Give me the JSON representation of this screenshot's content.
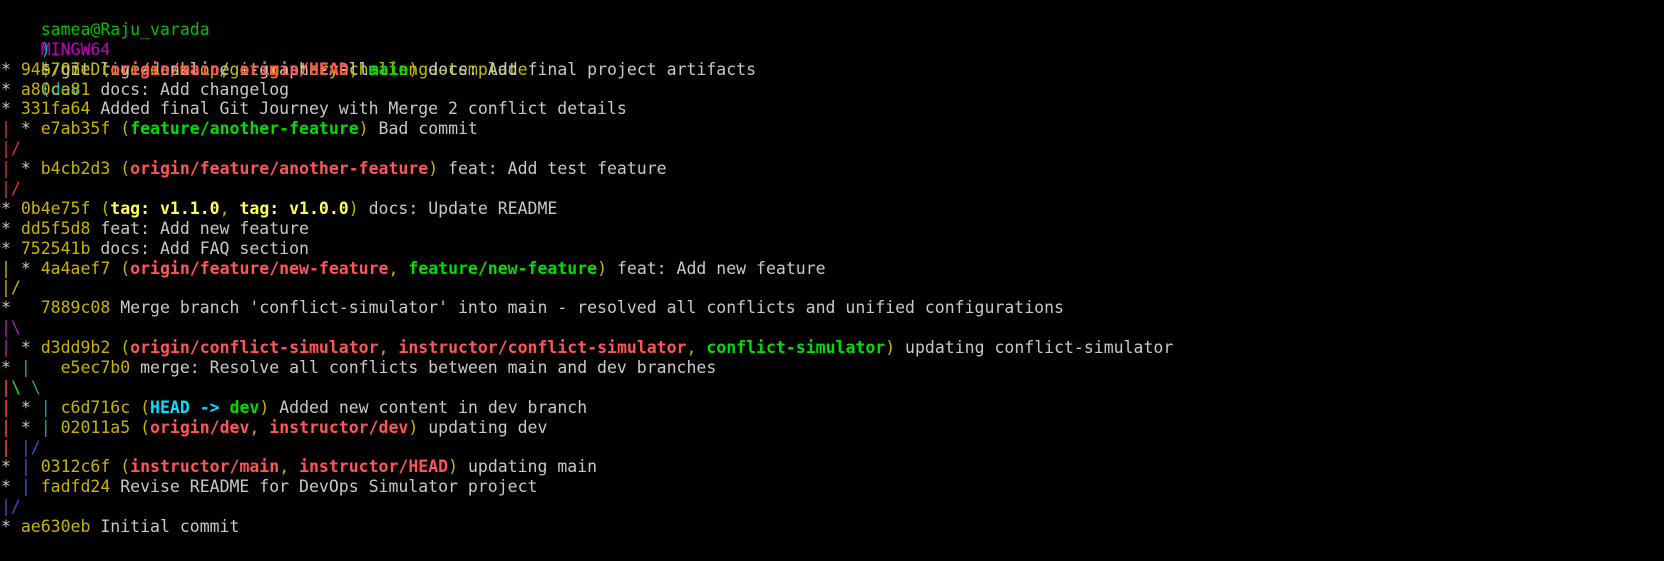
{
  "palette": {
    "background": "#000000",
    "text": "#c8c8c8",
    "prompt_user": "#00c200",
    "prompt_system": "#c000c0",
    "prompt_path": "#c0c000",
    "prompt_branch": "#00b0c0",
    "hash": "#c8b400",
    "ref_remote": "#ff5555",
    "ref_local": "#00dd00",
    "ref_tag": "#ffff55",
    "ref_head": "#00e0ff",
    "graph_red": "#e03030",
    "graph_green": "#30c030",
    "graph_yellow": "#c8b400",
    "graph_blue": "#3050e0",
    "graph_magenta": "#b020b0",
    "graph_cyan": "#20a0b0"
  },
  "terminal": {
    "prompt": {
      "user_host": "samea@Raju_varada",
      "system": "MINGW64",
      "path": "~/OneDrive/desktop/git-mastery-challenge-template",
      "branch_open": "(dev",
      "branch_close": ")"
    },
    "command": "$ git log --oneline --graph --all",
    "lines": [
      [
        {
          "t": "* ",
          "c": "text"
        },
        {
          "t": "94b7c7e",
          "c": "hash"
        },
        {
          "t": " (",
          "c": "hash"
        },
        {
          "t": "origin/main",
          "c": "ref_remote",
          "b": true
        },
        {
          "t": ", ",
          "c": "hash"
        },
        {
          "t": "origin/HEAD",
          "c": "ref_remote",
          "b": true
        },
        {
          "t": ", ",
          "c": "hash"
        },
        {
          "t": "main",
          "c": "ref_local",
          "b": true
        },
        {
          "t": ")",
          "c": "hash"
        },
        {
          "t": " docs: Add final project artifacts",
          "c": "text"
        }
      ],
      [
        {
          "t": "* ",
          "c": "text"
        },
        {
          "t": "a80ca81",
          "c": "hash"
        },
        {
          "t": " docs: Add changelog",
          "c": "text"
        }
      ],
      [
        {
          "t": "* ",
          "c": "text"
        },
        {
          "t": "331fa64",
          "c": "hash"
        },
        {
          "t": " Added final Git Journey with Merge 2 conflict details",
          "c": "text"
        }
      ],
      [
        {
          "t": "|",
          "c": "graph_red"
        },
        {
          "t": " * ",
          "c": "text"
        },
        {
          "t": "e7ab35f",
          "c": "hash"
        },
        {
          "t": " (",
          "c": "hash"
        },
        {
          "t": "feature/another-feature",
          "c": "ref_local",
          "b": true
        },
        {
          "t": ")",
          "c": "hash"
        },
        {
          "t": " Bad commit",
          "c": "text"
        }
      ],
      [
        {
          "t": "|/",
          "c": "graph_red"
        }
      ],
      [
        {
          "t": "|",
          "c": "graph_red"
        },
        {
          "t": " * ",
          "c": "text"
        },
        {
          "t": "b4cb2d3",
          "c": "hash"
        },
        {
          "t": " (",
          "c": "hash"
        },
        {
          "t": "origin/feature/another-feature",
          "c": "ref_remote",
          "b": true
        },
        {
          "t": ")",
          "c": "hash"
        },
        {
          "t": " feat: Add test feature",
          "c": "text"
        }
      ],
      [
        {
          "t": "|/",
          "c": "graph_red"
        }
      ],
      [
        {
          "t": "* ",
          "c": "text"
        },
        {
          "t": "0b4e75f",
          "c": "hash"
        },
        {
          "t": " (",
          "c": "hash"
        },
        {
          "t": "tag: v1.1.0",
          "c": "ref_tag",
          "b": true
        },
        {
          "t": ", ",
          "c": "hash"
        },
        {
          "t": "tag: v1.0.0",
          "c": "ref_tag",
          "b": true
        },
        {
          "t": ")",
          "c": "hash"
        },
        {
          "t": " docs: Update README",
          "c": "text"
        }
      ],
      [
        {
          "t": "* ",
          "c": "text"
        },
        {
          "t": "dd5f5d8",
          "c": "hash"
        },
        {
          "t": " feat: Add new feature",
          "c": "text"
        }
      ],
      [
        {
          "t": "* ",
          "c": "text"
        },
        {
          "t": "752541b",
          "c": "hash"
        },
        {
          "t": " docs: Add FAQ section",
          "c": "text"
        }
      ],
      [
        {
          "t": "|",
          "c": "graph_yellow"
        },
        {
          "t": " * ",
          "c": "text"
        },
        {
          "t": "4a4aef7",
          "c": "hash"
        },
        {
          "t": " (",
          "c": "hash"
        },
        {
          "t": "origin/feature/new-feature",
          "c": "ref_remote",
          "b": true
        },
        {
          "t": ", ",
          "c": "hash"
        },
        {
          "t": "feature/new-feature",
          "c": "ref_local",
          "b": true
        },
        {
          "t": ")",
          "c": "hash"
        },
        {
          "t": " feat: Add new feature",
          "c": "text"
        }
      ],
      [
        {
          "t": "|/",
          "c": "graph_yellow"
        }
      ],
      [
        {
          "t": "*   ",
          "c": "text"
        },
        {
          "t": "7889c08",
          "c": "hash"
        },
        {
          "t": " Merge branch 'conflict-simulator' into main - resolved all conflicts and unified configurations",
          "c": "text"
        }
      ],
      [
        {
          "t": "|\\",
          "c": "graph_magenta"
        }
      ],
      [
        {
          "t": "|",
          "c": "graph_magenta"
        },
        {
          "t": " * ",
          "c": "text"
        },
        {
          "t": "d3dd9b2",
          "c": "hash"
        },
        {
          "t": " (",
          "c": "hash"
        },
        {
          "t": "origin/conflict-simulator",
          "c": "ref_remote",
          "b": true
        },
        {
          "t": ", ",
          "c": "hash"
        },
        {
          "t": "instructor/conflict-simulator",
          "c": "ref_remote",
          "b": true
        },
        {
          "t": ", ",
          "c": "hash"
        },
        {
          "t": "conflict-simulator",
          "c": "ref_local",
          "b": true
        },
        {
          "t": ")",
          "c": "hash"
        },
        {
          "t": " updating conflict-simulator",
          "c": "text"
        }
      ],
      [
        {
          "t": "* ",
          "c": "text"
        },
        {
          "t": "|",
          "c": "graph_cyan"
        },
        {
          "t": "   ",
          "c": "text"
        },
        {
          "t": "e5ec7b0",
          "c": "hash"
        },
        {
          "t": " merge: Resolve all conflicts between main and dev branches",
          "c": "text"
        }
      ],
      [
        {
          "t": "|",
          "c": "graph_red",
          "b": true
        },
        {
          "t": "\\",
          "c": "graph_green",
          "b": true
        },
        {
          "t": " ",
          "c": "text"
        },
        {
          "t": "\\",
          "c": "graph_cyan"
        }
      ],
      [
        {
          "t": "|",
          "c": "graph_red",
          "b": true
        },
        {
          "t": " * ",
          "c": "text"
        },
        {
          "t": "|",
          "c": "graph_cyan"
        },
        {
          "t": " ",
          "c": "text"
        },
        {
          "t": "c6d716c",
          "c": "hash"
        },
        {
          "t": " (",
          "c": "hash"
        },
        {
          "t": "HEAD -> ",
          "c": "ref_head",
          "b": true
        },
        {
          "t": "dev",
          "c": "ref_local",
          "b": true
        },
        {
          "t": ")",
          "c": "hash"
        },
        {
          "t": " Added new content in dev branch",
          "c": "text"
        }
      ],
      [
        {
          "t": "|",
          "c": "graph_red",
          "b": true
        },
        {
          "t": " * ",
          "c": "text"
        },
        {
          "t": "|",
          "c": "graph_cyan"
        },
        {
          "t": " ",
          "c": "text"
        },
        {
          "t": "02011a5",
          "c": "hash"
        },
        {
          "t": " (",
          "c": "hash"
        },
        {
          "t": "origin/dev",
          "c": "ref_remote",
          "b": true
        },
        {
          "t": ", ",
          "c": "hash"
        },
        {
          "t": "instructor/dev",
          "c": "ref_remote",
          "b": true
        },
        {
          "t": ")",
          "c": "hash"
        },
        {
          "t": " updating dev",
          "c": "text"
        }
      ],
      [
        {
          "t": "|",
          "c": "graph_red",
          "b": true
        },
        {
          "t": " ",
          "c": "text"
        },
        {
          "t": "|/",
          "c": "graph_blue"
        }
      ],
      [
        {
          "t": "* ",
          "c": "text"
        },
        {
          "t": "|",
          "c": "graph_blue"
        },
        {
          "t": " ",
          "c": "text"
        },
        {
          "t": "0312c6f",
          "c": "hash"
        },
        {
          "t": " (",
          "c": "hash"
        },
        {
          "t": "instructor/main",
          "c": "ref_remote",
          "b": true
        },
        {
          "t": ", ",
          "c": "hash"
        },
        {
          "t": "instructor/HEAD",
          "c": "ref_remote",
          "b": true
        },
        {
          "t": ")",
          "c": "hash"
        },
        {
          "t": " updating main",
          "c": "text"
        }
      ],
      [
        {
          "t": "* ",
          "c": "text"
        },
        {
          "t": "|",
          "c": "graph_blue"
        },
        {
          "t": " ",
          "c": "text"
        },
        {
          "t": "fadfd24",
          "c": "hash"
        },
        {
          "t": " Revise README for DevOps Simulator project",
          "c": "text"
        }
      ],
      [
        {
          "t": "|/",
          "c": "graph_blue"
        }
      ],
      [
        {
          "t": "* ",
          "c": "text"
        },
        {
          "t": "ae630eb",
          "c": "hash"
        },
        {
          "t": " Initial commit",
          "c": "text"
        }
      ]
    ]
  }
}
